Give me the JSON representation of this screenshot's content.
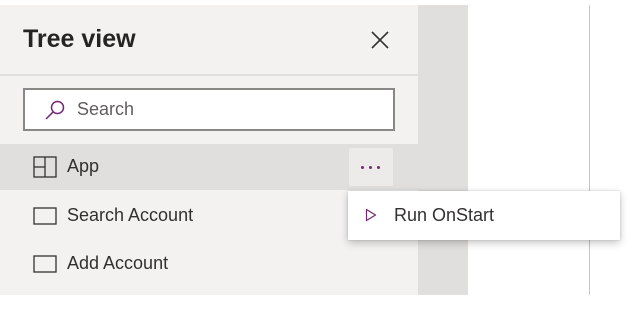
{
  "tree_view": {
    "title": "Tree view",
    "close_icon": "close-icon",
    "search": {
      "placeholder": "Search",
      "value": "",
      "icon": "search-icon"
    },
    "items": [
      {
        "label": "App",
        "icon": "app-grid-icon",
        "selected": true,
        "more_icon": "more-options-icon"
      },
      {
        "label": "Search Account",
        "icon": "screen-icon",
        "selected": false
      },
      {
        "label": "Add Account",
        "icon": "screen-icon",
        "selected": false
      }
    ]
  },
  "context_menu": {
    "items": [
      {
        "label": "Run OnStart",
        "icon": "play-icon"
      }
    ]
  },
  "colors": {
    "accent": "#742774",
    "panel_bg": "#f3f2f1",
    "selected_bg": "#e1dfdd"
  }
}
